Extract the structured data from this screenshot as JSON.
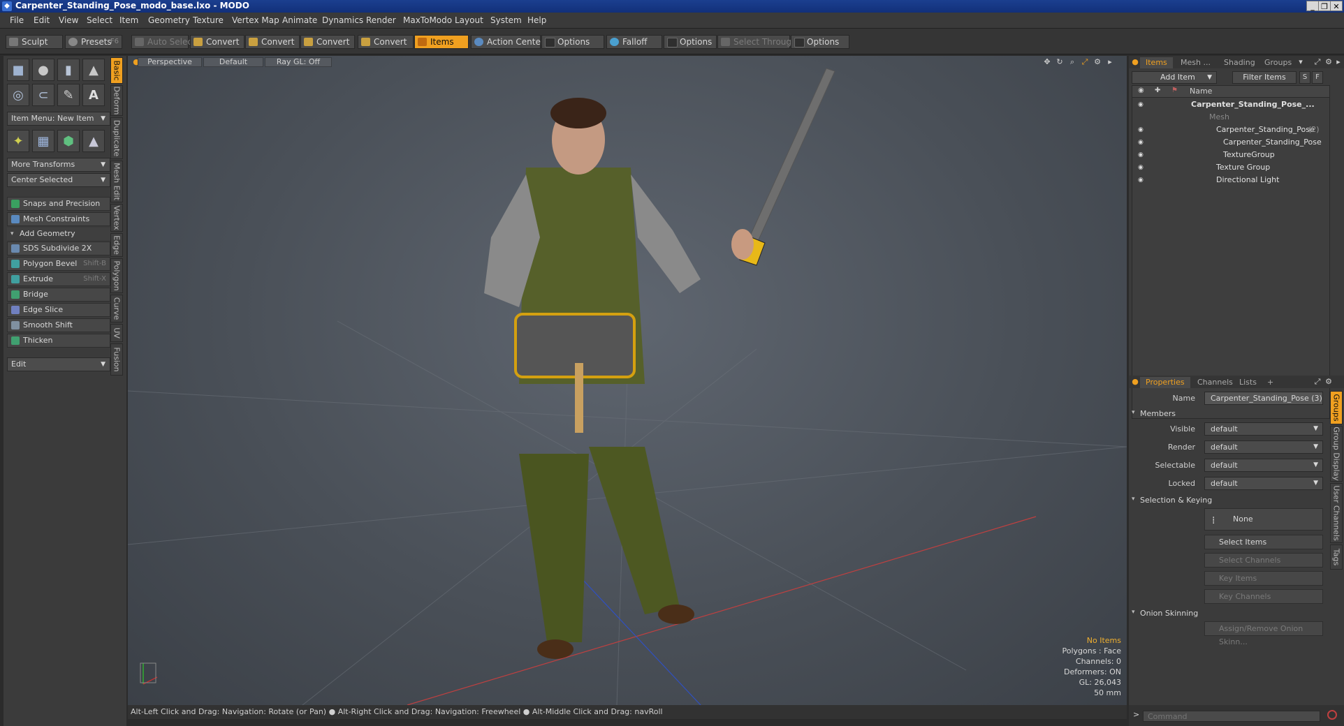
{
  "title": "Carpenter_Standing_Pose_modo_base.lxo - MODO",
  "menu": [
    "File",
    "Edit",
    "View",
    "Select",
    "Item",
    "Geometry",
    "Texture",
    "Vertex Map",
    "Animate",
    "Dynamics",
    "Render",
    "MaxToModo",
    "Layout",
    "System",
    "Help"
  ],
  "toolbar": {
    "sculpt": "Sculpt",
    "presets": "Presets",
    "presets_shortcut": "F6",
    "auto_select": "Auto Select",
    "convert1": "Convert",
    "convert2": "Convert",
    "convert3": "Convert",
    "convert4": "Convert",
    "items": "Items",
    "action_center": "Action Center",
    "options1": "Options",
    "falloff": "Falloff",
    "options2": "Options",
    "select_through": "Select Through",
    "options3": "Options"
  },
  "left": {
    "item_menu": "Item Menu: New Item",
    "more_transforms": "More Transforms",
    "center_selected": "Center Selected",
    "snaps": "Snaps and Precision",
    "mesh_constraints": "Mesh Constraints",
    "add_geometry": "Add Geometry",
    "tools": [
      {
        "label": "SDS Subdivide 2X",
        "shortcut": ""
      },
      {
        "label": "Polygon Bevel",
        "shortcut": "Shift-B"
      },
      {
        "label": "Extrude",
        "shortcut": "Shift-X"
      },
      {
        "label": "Bridge",
        "shortcut": ""
      },
      {
        "label": "Edge Slice",
        "shortcut": ""
      },
      {
        "label": "Smooth Shift",
        "shortcut": ""
      },
      {
        "label": "Thicken",
        "shortcut": ""
      }
    ],
    "edit": "Edit",
    "vtabs": [
      "Basic",
      "Deform",
      "Duplicate",
      "Mesh Edit",
      "Vertex",
      "Edge",
      "Polygon",
      "Curve",
      "UV",
      "Fusion"
    ]
  },
  "viewport": {
    "view": "Perspective",
    "shading": "Default",
    "raygl": "Ray GL: Off",
    "hud": {
      "no_items": "No Items",
      "polygons": "Polygons : Face",
      "channels": "Channels: 0",
      "deformers": "Deformers: ON",
      "gl": "GL: 26,043",
      "size": "50 mm"
    }
  },
  "status": "Alt-Left Click and Drag: Navigation: Rotate (or Pan) ● Alt-Right Click and Drag: Navigation: Freewheel ● Alt-Middle Click and Drag: navRoll",
  "items_panel": {
    "tabs": [
      "Items",
      "Mesh ...",
      "Shading",
      "Groups"
    ],
    "add_item": "Add Item",
    "filter": "Filter Items",
    "s": "S",
    "f": "F",
    "col_name": "Name",
    "rows": [
      {
        "label": "Carpenter_Standing_Pose_...",
        "suffix": ""
      },
      {
        "label": "Mesh",
        "suffix": ""
      },
      {
        "label": "Carpenter_Standing_Pose",
        "suffix": "(2)"
      },
      {
        "label": "Carpenter_Standing_Pose",
        "suffix": ""
      },
      {
        "label": "TextureGroup",
        "suffix": ""
      },
      {
        "label": "Texture Group",
        "suffix": ""
      },
      {
        "label": "Directional Light",
        "suffix": ""
      }
    ]
  },
  "props_panel": {
    "tabs": [
      "Properties",
      "Channels",
      "Lists",
      "+"
    ],
    "name_label": "Name",
    "name_value": "Carpenter_Standing_Pose (3)",
    "members": "Members",
    "visible": "Visible",
    "render": "Render",
    "selectable": "Selectable",
    "locked": "Locked",
    "default": "default",
    "selection_keying": "Selection & Keying",
    "none": "None",
    "select_items": "Select Items",
    "select_channels": "Select Channels",
    "key_items": "Key Items",
    "key_channels": "Key Channels",
    "onion": "Onion Skinning",
    "assign_onion": "Assign/Remove Onion Skinn...",
    "vtabs": [
      "Groups",
      "Group Display",
      "User Channels",
      "Tags"
    ]
  },
  "command_placeholder": "Command",
  "colors": {
    "accent": "#f0a020",
    "titlebar": "#12307a",
    "viewport": "#4a5058"
  }
}
